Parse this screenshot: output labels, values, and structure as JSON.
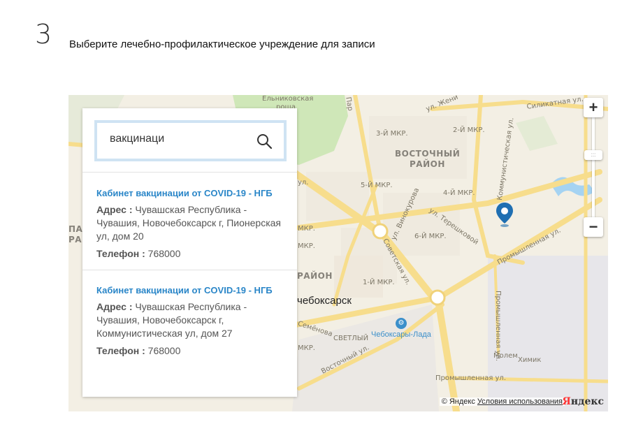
{
  "step": {
    "number": "3",
    "title": "Выберите лечебно-профилактическое учреждение для записи"
  },
  "search": {
    "value": "вакцинаци",
    "icon": "search-icon"
  },
  "results": [
    {
      "title": "Кабинет вакцинации от COVID-19 - НГБ",
      "address_label": "Адрес :",
      "address": "Чувашская Республика - Чувашия, Новочебоксарск г, Пионерская ул, дом 20",
      "phone_label": "Телефон :",
      "phone": "768000"
    },
    {
      "title": "Кабинет вакцинации от COVID-19 - НГБ",
      "address_label": "Адрес :",
      "address": "Чувашская Республика - Чувашия, Новочебоксарск г, Коммунистическая ул, дом 27",
      "phone_label": "Телефон :",
      "phone": "768000"
    }
  ],
  "map": {
    "labels": {
      "elnikovskaya": "Ельниковская",
      "roshcha": "роща",
      "zheni": "ул. Жени",
      "silikatnaya": "Силикатная ул.",
      "mkr3": "3-Й МКР.",
      "mkr2": "2-Й МКР.",
      "vostochny": "ВОСТОЧНЫЙ",
      "rayon": "РАЙОН",
      "kommunisticheskaya": "Коммунистическая ул.",
      "mkr5": "5-Й МКР.",
      "mkr4": "4-Й МКР.",
      "vinokurova": "ул. Винокурова",
      "tereshkovoy": "ул. Терешковой",
      "mkr6": "6-Й МКР.",
      "promyshlennaya1": "Промышленная ул.",
      "sovetskaya": "Советская ул.",
      "mkr1": "1-Й МКР.",
      "rayon2": "РАЙОН",
      "city": "чебоксарск",
      "semenova": "Семёнова",
      "svetly": "СВЕТЛЫЙ",
      "cheboksary_lada": "Чебоксары-Лада",
      "vostochnaya": "Восточный ул.",
      "molem": "Молем",
      "khimik": "Химик",
      "promyshlennaya2": "Промышленная ул.",
      "promyshlennaya3": "Промышленная ул.",
      "left_pa": "ПА",
      "left_ra": "РА",
      "mkr_left1": "МКР.",
      "mkr_left2": "МКР.",
      "mkr_left3": "МКР.",
      "ul_left": "ул.",
      "parkovaya": "Пар"
    },
    "zoom_in": "+",
    "zoom_out": "−",
    "zoom_handle": ":::",
    "copyright": "© Яндекс",
    "terms": "Условия использования",
    "logo_first": "Я",
    "logo_rest": "ндекс",
    "marker_color": "#1f6fb2",
    "road_color": "#f7dd8c",
    "park_color": "#cfe7b8",
    "water_color": "#a5d3f2"
  }
}
